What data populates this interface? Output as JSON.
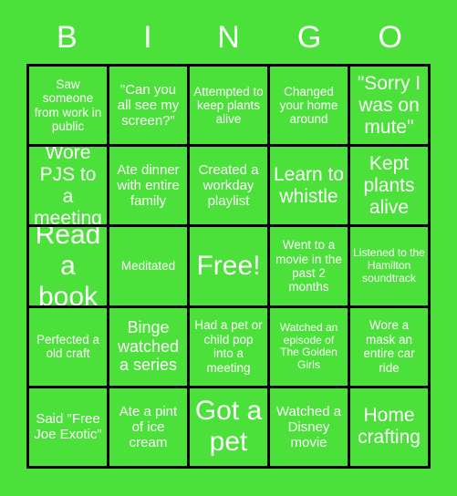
{
  "card": {
    "title": "BINGO",
    "background_color": "#4ce03a",
    "cell_color": "#4ce03a",
    "grid_line_color": "#000000",
    "text_color": "#ffffff"
  },
  "header": {
    "letters": [
      {
        "label": "B"
      },
      {
        "label": "I"
      },
      {
        "label": "N"
      },
      {
        "label": "G"
      },
      {
        "label": "O"
      }
    ]
  },
  "grid": {
    "rows": 5,
    "columns": 5,
    "cells": [
      {
        "text": "Saw someone from work in public",
        "size": "sm"
      },
      {
        "text": "\"Can you all see my screen?\"",
        "size": "md"
      },
      {
        "text": "Attempted to keep plants alive",
        "size": "sm"
      },
      {
        "text": "Changed your home around",
        "size": "sm"
      },
      {
        "text": "\"Sorry I was on mute\"",
        "size": "xl"
      },
      {
        "text": "Wore PJS to a meeting",
        "size": "xl"
      },
      {
        "text": "Ate dinner with entire family",
        "size": "md"
      },
      {
        "text": "Created a workday playlist",
        "size": "md"
      },
      {
        "text": "Learn to whistle",
        "size": "xl"
      },
      {
        "text": "Kept plants alive",
        "size": "xl"
      },
      {
        "text": "Read a book",
        "size": "xxl"
      },
      {
        "text": "Meditated",
        "size": "sm"
      },
      {
        "text": "Free!",
        "size": "xxl"
      },
      {
        "text": "Went to a movie in the past 2 months",
        "size": "sm"
      },
      {
        "text": "Listened to the Hamilton soundtrack",
        "size": "xs"
      },
      {
        "text": "Perfected a old craft",
        "size": "sm"
      },
      {
        "text": "Binge watched a series",
        "size": "lg"
      },
      {
        "text": "Had a pet or child pop into a meeting",
        "size": "sm"
      },
      {
        "text": "Watched an episode of The Golden Girls",
        "size": "xs"
      },
      {
        "text": "Wore a mask an entire car ride",
        "size": "sm"
      },
      {
        "text": "Said \"Free Joe Exotic\"",
        "size": "md"
      },
      {
        "text": "Ate a pint of ice cream",
        "size": "md"
      },
      {
        "text": "Got a pet",
        "size": "xxl"
      },
      {
        "text": "Watched a Disney movie",
        "size": "md"
      },
      {
        "text": "Home crafting",
        "size": "xl"
      }
    ]
  }
}
